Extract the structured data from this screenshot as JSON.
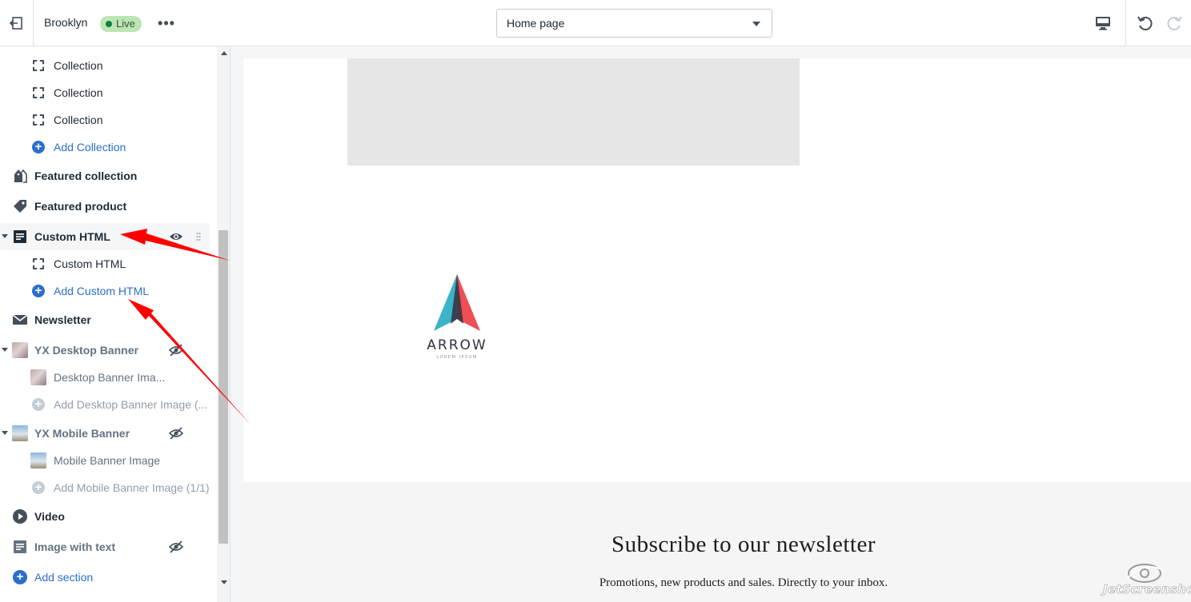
{
  "header": {
    "theme_name": "Brooklyn",
    "live_badge": "Live",
    "page_select": {
      "value": "Home page"
    }
  },
  "sidebar": {
    "items": [
      {
        "label": "Collection"
      },
      {
        "label": "Collection"
      },
      {
        "label": "Collection"
      },
      {
        "label": "Add Collection"
      },
      {
        "label": "Featured collection"
      },
      {
        "label": "Featured product"
      },
      {
        "label": "Custom HTML"
      },
      {
        "label": "Custom HTML"
      },
      {
        "label": "Add Custom HTML"
      },
      {
        "label": "Newsletter"
      },
      {
        "label": "YX Desktop Banner"
      },
      {
        "label": "Desktop Banner Ima..."
      },
      {
        "label": "Add Desktop Banner Image (..."
      },
      {
        "label": "YX Mobile Banner"
      },
      {
        "label": "Mobile Banner Image"
      },
      {
        "label": "Add Mobile Banner Image (1/1)"
      },
      {
        "label": "Video"
      },
      {
        "label": "Image with text"
      },
      {
        "label": "Add section"
      }
    ]
  },
  "preview": {
    "logo": {
      "name": "ARROW",
      "tagline": "LOREM IPSUM"
    },
    "newsletter": {
      "title": "Subscribe to our newsletter",
      "subtitle": "Promotions, new products and sales. Directly to your inbox."
    }
  },
  "watermark": "JetScreenshot",
  "colors": {
    "accent": "#2c6ecb",
    "live_badge_bg": "#bbe5b3",
    "annotation_arrow": "#ff0000",
    "logo_teal": "#3bb3c9",
    "logo_red": "#ef4e56",
    "logo_dark": "#2f3341"
  }
}
